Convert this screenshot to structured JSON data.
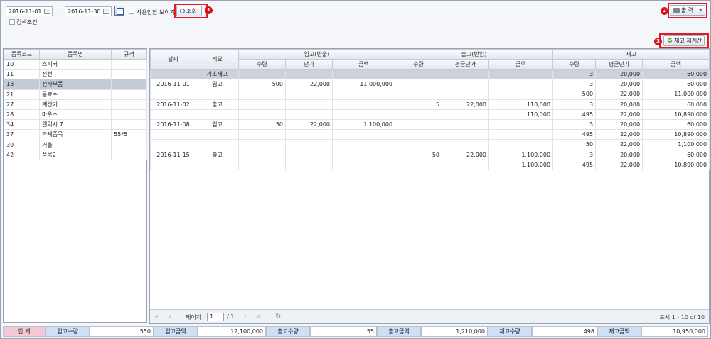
{
  "filter": {
    "date_from": "2016-11-01",
    "tilde": "~",
    "date_to": "2016-11-30",
    "show_unused_label": "사용안함 보이기",
    "search_label": "조회",
    "conditions_label": "검색조건",
    "print_label": "출 력",
    "recalc_label": "재고 재계산"
  },
  "badges": [
    "1",
    "2",
    "3"
  ],
  "items": {
    "headers": [
      "품목코드",
      "품목명",
      "규격"
    ],
    "rows": [
      [
        "10",
        "스피커",
        ""
      ],
      [
        "11",
        "전선",
        ""
      ],
      [
        "13",
        "전자부품",
        ""
      ],
      [
        "21",
        "음료수",
        ""
      ],
      [
        "27",
        "계산기",
        ""
      ],
      [
        "28",
        "마우스",
        ""
      ],
      [
        "34",
        "갤럭시 7",
        ""
      ],
      [
        "37",
        "과세품목",
        "55*5"
      ],
      [
        "39",
        "거울",
        ""
      ],
      [
        "42",
        "품목2",
        ""
      ]
    ],
    "selected_index": 2
  },
  "ledger": {
    "h_date": "날짜",
    "h_memo": "적요",
    "h_in": "입고(반출)",
    "h_out": "출고(반입)",
    "h_stock": "재고",
    "sub": [
      "수량",
      "단가",
      "금액",
      "수량",
      "평균단가",
      "금액",
      "수량",
      "평균단가",
      "금액"
    ],
    "rows": [
      [
        "",
        "기초재고",
        "",
        "",
        "",
        "",
        "",
        "",
        "3",
        "20,000",
        "60,000"
      ],
      [
        "2016-11-01",
        "입고",
        "500",
        "22,000",
        "11,000,000",
        "",
        "",
        "",
        "3",
        "20,000",
        "60,000"
      ],
      [
        "",
        "",
        "",
        "",
        "",
        "",
        "",
        "",
        "500",
        "22,000",
        "11,000,000"
      ],
      [
        "2016-11-02",
        "출고",
        "",
        "",
        "",
        "5",
        "22,000",
        "110,000",
        "3",
        "20,000",
        "60,000"
      ],
      [
        "",
        "",
        "",
        "",
        "",
        "",
        "",
        "110,000",
        "495",
        "22,000",
        "10,890,000"
      ],
      [
        "2016-11-08",
        "입고",
        "50",
        "22,000",
        "1,100,000",
        "",
        "",
        "",
        "3",
        "20,000",
        "60,000"
      ],
      [
        "",
        "",
        "",
        "",
        "",
        "",
        "",
        "",
        "495",
        "22,000",
        "10,890,000"
      ],
      [
        "",
        "",
        "",
        "",
        "",
        "",
        "",
        "",
        "50",
        "22,000",
        "1,100,000"
      ],
      [
        "2016-11-15",
        "출고",
        "",
        "",
        "",
        "50",
        "22,000",
        "1,100,000",
        "3",
        "20,000",
        "60,000"
      ],
      [
        "",
        "",
        "",
        "",
        "",
        "",
        "",
        "1,100,000",
        "495",
        "22,000",
        "10,890,000"
      ]
    ]
  },
  "pager": {
    "page_label": "페이지",
    "page": "1",
    "of": "/ 1",
    "display": "표시 1 - 10 of 10"
  },
  "totals": {
    "label": "합 계",
    "in_qty_label": "입고수량",
    "in_qty": "550",
    "in_amt_label": "입고금액",
    "in_amt": "12,100,000",
    "out_qty_label": "출고수량",
    "out_qty": "55",
    "out_amt_label": "출고금액",
    "out_amt": "1,210,000",
    "stock_qty_label": "재고수량",
    "stock_qty": "498",
    "stock_amt_label": "재고금액",
    "stock_amt": "10,950,000"
  },
  "colors": {
    "highlight": "#e31b23",
    "selected_row": "#c3cbd9",
    "footer_label": "#cfe0f6",
    "total_label": "#f6c7d4"
  }
}
